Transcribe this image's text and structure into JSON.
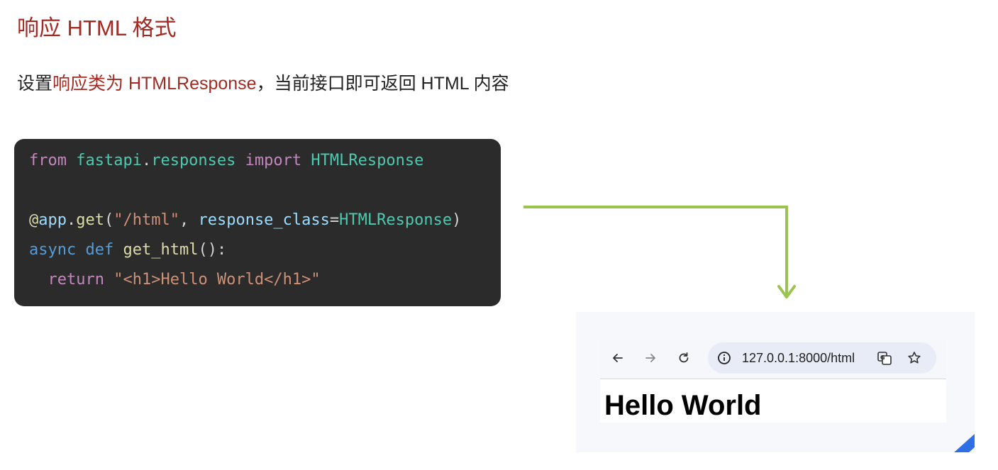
{
  "heading": "响应 HTML 格式",
  "description": {
    "prefix": "设置",
    "highlight": "响应类为 HTMLResponse",
    "suffix": "，当前接口即可返回 HTML 内容"
  },
  "code": {
    "line1": {
      "from": "from",
      "module1": "fastapi",
      "dot": ".",
      "module2": "responses",
      "import": "import",
      "cls": "HTMLResponse"
    },
    "line3": {
      "at": "@",
      "obj": "app",
      "dot": ".",
      "method": "get",
      "lp": "(",
      "path": "\"/html\"",
      "comma": ", ",
      "param": "response_class",
      "eq": "=",
      "cls": "HTMLResponse",
      "rp": ")"
    },
    "line4": {
      "async": "async",
      "def": "def",
      "fn": "get_html",
      "paren": "():"
    },
    "line5": {
      "ret": "return",
      "str": "\"<h1>Hello World</h1>\""
    }
  },
  "browser": {
    "url": "127.0.0.1:8000/html",
    "page_heading": "Hello World",
    "icons": [
      "back-arrow-icon",
      "forward-arrow-icon",
      "reload-icon",
      "info-icon",
      "translate-icon",
      "star-icon"
    ]
  },
  "colors": {
    "accent_red": "#a32a22",
    "arrow_green": "#9bc34f",
    "corner_blue": "#2f6fe6",
    "code_bg": "#2b2b2b"
  }
}
